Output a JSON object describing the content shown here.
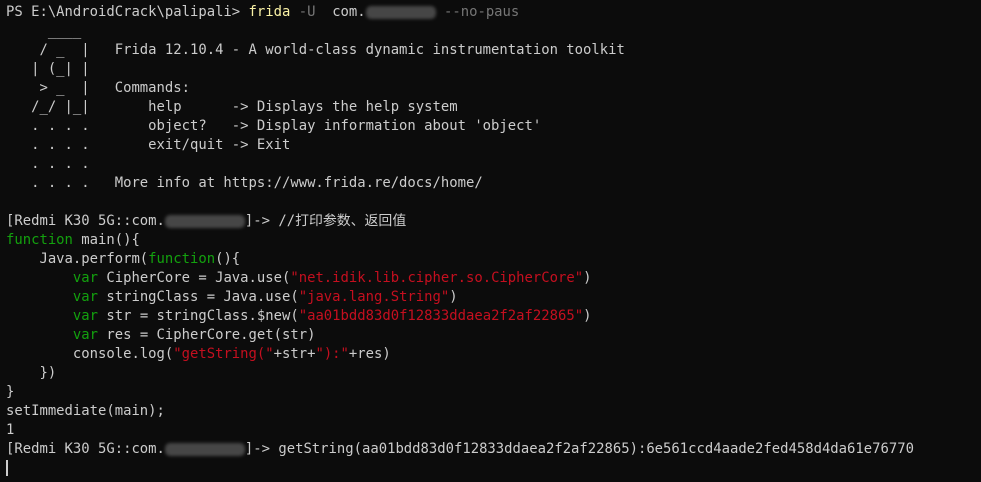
{
  "terminal": {
    "colors": {
      "background": "#0c0c0c",
      "text": "#cccccc",
      "command": "#f9f1a5",
      "argument": "#767676",
      "keyword": "#13a10e",
      "string": "#c50f1f"
    },
    "lines": [
      [
        {
          "t": "PS E:\\AndroidCrack\\palipali> ",
          "c": "default"
        },
        {
          "t": "frida",
          "c": "yellow"
        },
        {
          "t": " -U  ",
          "c": "gray"
        },
        {
          "t": "com.",
          "c": "default"
        },
        {
          "redact": 70
        },
        {
          "t": " --no-paus",
          "c": "gray"
        }
      ],
      [
        {
          "t": "     ____",
          "c": "default"
        }
      ],
      [
        {
          "t": "    / _  |   Frida 12.10.4 - A world-class dynamic instrumentation toolkit",
          "c": "default"
        }
      ],
      [
        {
          "t": "   | (_| |",
          "c": "default"
        }
      ],
      [
        {
          "t": "    > _  |   Commands:",
          "c": "default"
        }
      ],
      [
        {
          "t": "   /_/ |_|       help      -> Displays the help system",
          "c": "default"
        }
      ],
      [
        {
          "t": "   . . . .       object?   -> Display information about 'object'",
          "c": "default"
        }
      ],
      [
        {
          "t": "   . . . .       exit/quit -> Exit",
          "c": "default"
        }
      ],
      [
        {
          "t": "   . . . .",
          "c": "default"
        }
      ],
      [
        {
          "t": "   . . . .   More info at https://www.frida.re/docs/home/",
          "c": "default"
        }
      ],
      [],
      [
        {
          "t": "[Redmi K30 5G::com.",
          "c": "default"
        },
        {
          "redact": 80
        },
        {
          "t": "]-> //打印参数、返回值",
          "c": "default"
        }
      ],
      [
        {
          "t": "function",
          "c": "green"
        },
        {
          "t": " main(){",
          "c": "default"
        }
      ],
      [
        {
          "t": "    Java.perform(",
          "c": "default"
        },
        {
          "t": "function",
          "c": "green"
        },
        {
          "t": "(){",
          "c": "default"
        }
      ],
      [
        {
          "t": "        ",
          "c": "default"
        },
        {
          "t": "var",
          "c": "green"
        },
        {
          "t": " CipherCore = Java.use(",
          "c": "default"
        },
        {
          "t": "\"net.idik.lib.cipher.so.CipherCore\"",
          "c": "red"
        },
        {
          "t": ")",
          "c": "default"
        }
      ],
      [
        {
          "t": "        ",
          "c": "default"
        },
        {
          "t": "var",
          "c": "green"
        },
        {
          "t": " stringClass = Java.use(",
          "c": "default"
        },
        {
          "t": "\"java.lang.String\"",
          "c": "red"
        },
        {
          "t": ")",
          "c": "default"
        }
      ],
      [
        {
          "t": "        ",
          "c": "default"
        },
        {
          "t": "var",
          "c": "green"
        },
        {
          "t": " str = stringClass.$new(",
          "c": "default"
        },
        {
          "t": "\"aa01bdd83d0f12833ddaea2f2af22865\"",
          "c": "red"
        },
        {
          "t": ")",
          "c": "default"
        }
      ],
      [
        {
          "t": "        ",
          "c": "default"
        },
        {
          "t": "var",
          "c": "green"
        },
        {
          "t": " res = CipherCore.get(str)",
          "c": "default"
        }
      ],
      [
        {
          "t": "        console.log(",
          "c": "default"
        },
        {
          "t": "\"getString(\"",
          "c": "red"
        },
        {
          "t": "+str+",
          "c": "default"
        },
        {
          "t": "\"):\"",
          "c": "red"
        },
        {
          "t": "+res)",
          "c": "default"
        }
      ],
      [
        {
          "t": "    })",
          "c": "default"
        }
      ],
      [
        {
          "t": "}",
          "c": "default"
        }
      ],
      [
        {
          "t": "setImmediate(main);",
          "c": "default"
        }
      ],
      [
        {
          "t": "1",
          "c": "default"
        }
      ],
      [
        {
          "t": "[Redmi K30 5G::com.",
          "c": "default"
        },
        {
          "redact": 80
        },
        {
          "t": "]-> getString(aa01bdd83d0f12833ddaea2f2af22865):6e561ccd4aade2fed458d4da61e76770",
          "c": "default"
        }
      ]
    ]
  }
}
